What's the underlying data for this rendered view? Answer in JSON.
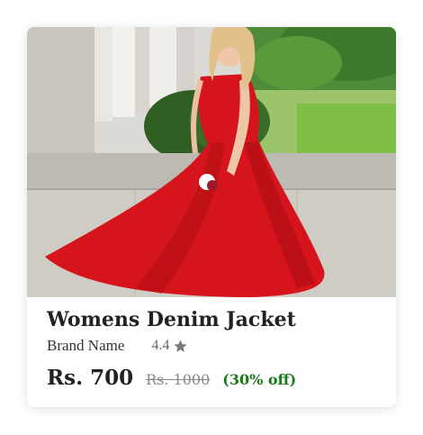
{
  "product": {
    "image_alt": "Woman in red flowing gown",
    "title": "Womens Denim Jacket",
    "brand": "Brand Name",
    "rating": "4.4",
    "rating_icon": "star-icon",
    "price": "Rs. 700",
    "original_price": "Rs. 1000",
    "discount": "(30% off)"
  },
  "colors": {
    "dress": "#d6141b",
    "discount": "#1a7a1a",
    "star": "#7a7a7a"
  }
}
